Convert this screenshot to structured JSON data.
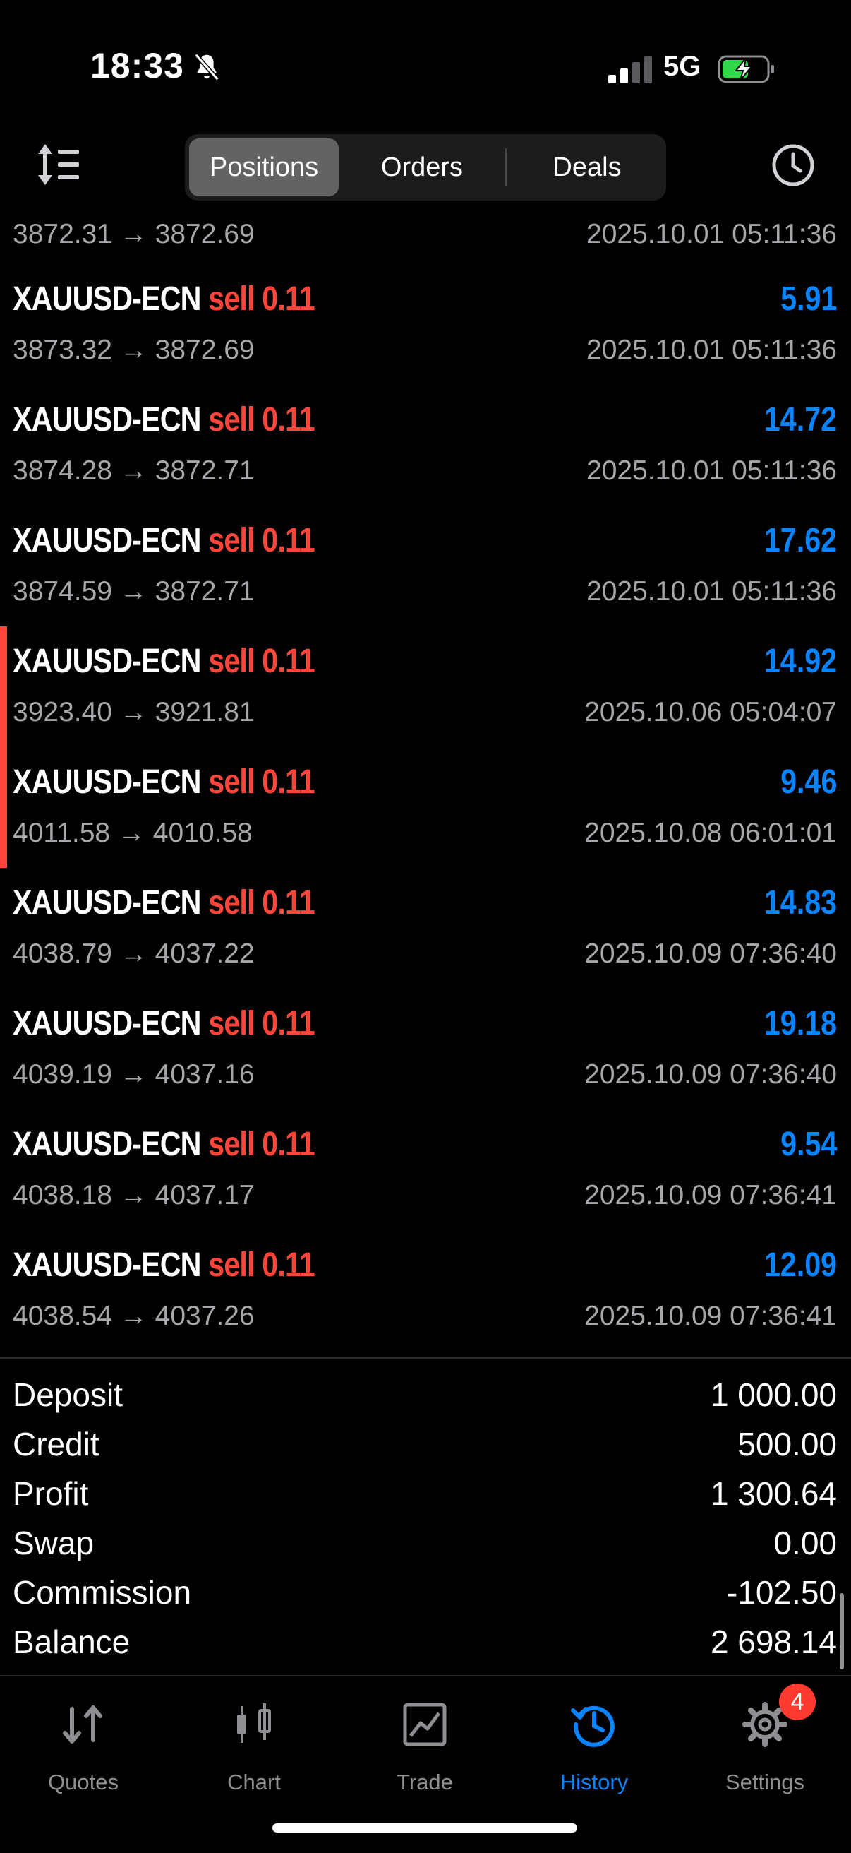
{
  "status": {
    "time": "18:33",
    "network": "5G"
  },
  "toolbar": {
    "tabs": [
      {
        "label": "Positions",
        "active": true
      },
      {
        "label": "Orders",
        "active": false
      },
      {
        "label": "Deals",
        "active": false
      }
    ]
  },
  "positions": [
    {
      "partial": true,
      "prices": "3872.31 → 3872.69",
      "datetime": "2025.10.01 05:11:36"
    },
    {
      "symbol": "XAUUSD-ECN",
      "side": "sell 0.11",
      "prices": "3873.32 → 3872.69",
      "profit": "5.91",
      "datetime": "2025.10.01 05:11:36"
    },
    {
      "symbol": "XAUUSD-ECN",
      "side": "sell 0.11",
      "prices": "3874.28 → 3872.71",
      "profit": "14.72",
      "datetime": "2025.10.01 05:11:36"
    },
    {
      "symbol": "XAUUSD-ECN",
      "side": "sell 0.11",
      "prices": "3874.59 → 3872.71",
      "profit": "17.62",
      "datetime": "2025.10.01 05:11:36"
    },
    {
      "symbol": "XAUUSD-ECN",
      "side": "sell 0.11",
      "prices": "3923.40 → 3921.81",
      "profit": "14.92",
      "datetime": "2025.10.06 05:04:07",
      "marked": true
    },
    {
      "symbol": "XAUUSD-ECN",
      "side": "sell 0.11",
      "prices": "4011.58 → 4010.58",
      "profit": "9.46",
      "datetime": "2025.10.08 06:01:01",
      "marked": true
    },
    {
      "symbol": "XAUUSD-ECN",
      "side": "sell 0.11",
      "prices": "4038.79 → 4037.22",
      "profit": "14.83",
      "datetime": "2025.10.09 07:36:40"
    },
    {
      "symbol": "XAUUSD-ECN",
      "side": "sell 0.11",
      "prices": "4039.19 → 4037.16",
      "profit": "19.18",
      "datetime": "2025.10.09 07:36:40"
    },
    {
      "symbol": "XAUUSD-ECN",
      "side": "sell 0.11",
      "prices": "4038.18 → 4037.17",
      "profit": "9.54",
      "datetime": "2025.10.09 07:36:41"
    },
    {
      "symbol": "XAUUSD-ECN",
      "side": "sell 0.11",
      "prices": "4038.54 → 4037.26",
      "profit": "12.09",
      "datetime": "2025.10.09 07:36:41"
    }
  ],
  "summary": [
    {
      "label": "Deposit",
      "value": "1 000.00"
    },
    {
      "label": "Credit",
      "value": "500.00"
    },
    {
      "label": "Profit",
      "value": "1 300.64"
    },
    {
      "label": "Swap",
      "value": "0.00"
    },
    {
      "label": "Commission",
      "value": "-102.50"
    },
    {
      "label": "Balance",
      "value": "2 698.14"
    }
  ],
  "tabbar": {
    "tabs": [
      {
        "label": "Quotes",
        "icon": "quotes-icon",
        "active": false
      },
      {
        "label": "Chart",
        "icon": "chart-icon",
        "active": false
      },
      {
        "label": "Trade",
        "icon": "trade-icon",
        "active": false
      },
      {
        "label": "History",
        "icon": "history-icon",
        "active": true
      },
      {
        "label": "Settings",
        "icon": "settings-icon",
        "active": false
      }
    ],
    "settings_badge": "4"
  },
  "colors": {
    "accent": "#0a84ff",
    "sell": "#ff453a",
    "muted": "#a7a7ab"
  }
}
